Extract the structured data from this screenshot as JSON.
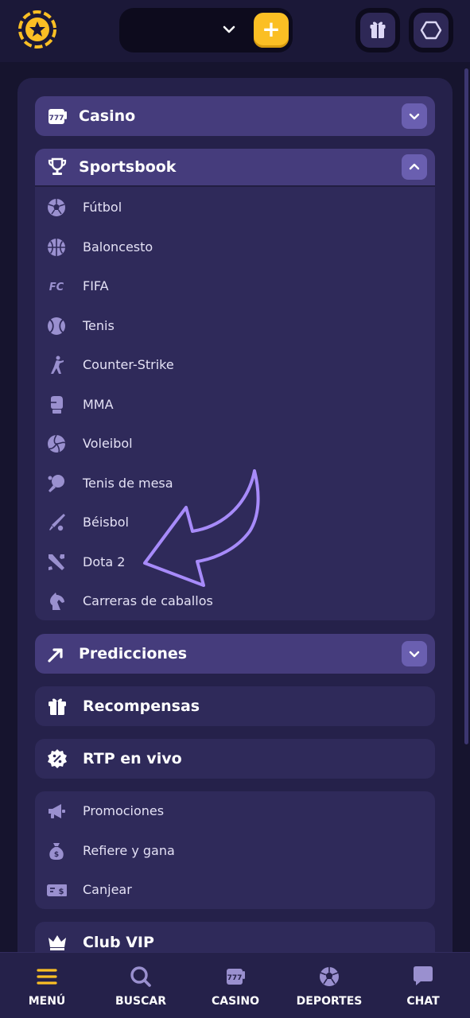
{
  "colors": {
    "accent": "#fbbf24",
    "section_header_bg": "#453c7c",
    "panel_bg": "#25214a",
    "item_icon": "#9a90cf",
    "toggle_bg": "#6a5fb0",
    "arrow": "#a78bfa"
  },
  "topbar": {
    "logo_icon": "star-coin-logo-icon",
    "wallet_dropdown_icon": "chevron-down-icon",
    "deposit_label": "+",
    "gift_icon": "gift-icon",
    "profile_icon": "hexagon-icon"
  },
  "menu": {
    "casino": {
      "label": "Casino",
      "icon": "slot-777-icon",
      "expanded": false
    },
    "sportsbook": {
      "label": "Sportsbook",
      "icon": "trophy-icon",
      "expanded": true,
      "items": [
        {
          "label": "Fútbol",
          "icon": "soccer-ball-icon"
        },
        {
          "label": "Baloncesto",
          "icon": "basketball-icon"
        },
        {
          "label": "FIFA",
          "icon": "fc-logo-icon"
        },
        {
          "label": "Tenis",
          "icon": "tennis-ball-icon"
        },
        {
          "label": "Counter-Strike",
          "icon": "soldier-icon"
        },
        {
          "label": "MMA",
          "icon": "boxing-glove-icon"
        },
        {
          "label": "Voleibol",
          "icon": "volleyball-icon"
        },
        {
          "label": "Tenis de mesa",
          "icon": "ping-pong-icon"
        },
        {
          "label": "Béisbol",
          "icon": "baseball-bat-icon"
        },
        {
          "label": "Dota 2",
          "icon": "crossed-swords-icon"
        },
        {
          "label": "Carreras de caballos",
          "icon": "horse-icon"
        }
      ]
    },
    "predicciones": {
      "label": "Predicciones",
      "icon": "trend-arrow-icon",
      "expanded": false
    },
    "recompensas": {
      "label": "Recompensas",
      "icon": "gift-icon"
    },
    "rtp": {
      "label": "RTP en vivo",
      "icon": "percent-badge-icon"
    },
    "extras": [
      {
        "label": "Promociones",
        "icon": "megaphone-icon"
      },
      {
        "label": "Refiere y gana",
        "icon": "money-bag-icon"
      },
      {
        "label": "Canjear",
        "icon": "voucher-icon"
      }
    ],
    "club_vip": {
      "label": "Club VIP",
      "icon": "crown-icon"
    }
  },
  "bottom_nav": [
    {
      "label": "MENÚ",
      "icon": "hamburger-icon",
      "active": true
    },
    {
      "label": "BUSCAR",
      "icon": "search-icon"
    },
    {
      "label": "CASINO",
      "icon": "slot-777-icon"
    },
    {
      "label": "DEPORTES",
      "icon": "soccer-ball-icon"
    },
    {
      "label": "CHAT",
      "icon": "chat-bubble-icon"
    }
  ]
}
